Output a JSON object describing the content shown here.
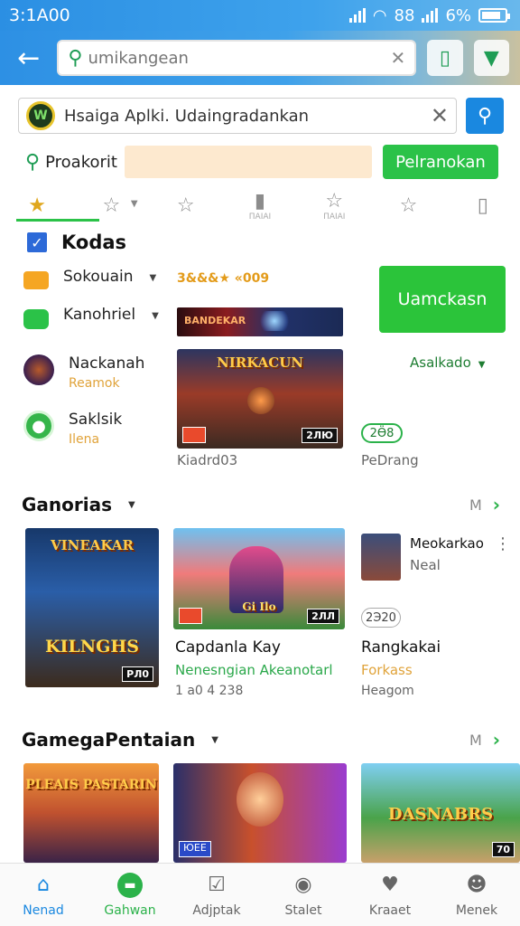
{
  "status_bar": {
    "time": "3:1A00",
    "right_text": "88",
    "battery_text": "6%"
  },
  "top_bar": {
    "search_placeholder": "umikangean"
  },
  "search2": {
    "text": "Hsaiga Aplki. Udaingradankan"
  },
  "filter": {
    "label": "Proakorit",
    "button": "Pelranokan"
  },
  "tabs": [
    {
      "name": "star-icon",
      "sub": ""
    },
    {
      "name": "star-outline-icon",
      "sub": ""
    },
    {
      "name": "star-outline-icon",
      "sub": ""
    },
    {
      "name": "folder-icon",
      "sub": "ПАІАІ"
    },
    {
      "name": "star-outline-icon",
      "sub": "ПАІАІ"
    },
    {
      "name": "star-outline-icon",
      "sub": ""
    },
    {
      "name": "bookmark-icon",
      "sub": ""
    }
  ],
  "kodas": {
    "title": "Kodas",
    "items": [
      {
        "label": "Sokouain",
        "sub": ""
      },
      {
        "label": "Kanohriel",
        "sub": ""
      },
      {
        "label": "Nackanah",
        "sub": "Reamok"
      },
      {
        "label": "Saklsik",
        "sub": "Ilena"
      }
    ],
    "rating_text": "3&&&★ «009",
    "banner_text": "BANDEKAR",
    "featured": {
      "art_title": "NIRKACUN",
      "tag": "2ЛЮ",
      "caption": "Kiadrd03"
    },
    "install_button": "Uamckasn",
    "asekado": "Asalkado",
    "pill": "2Ӫ8",
    "pill_caption": "PeDrang"
  },
  "section1": {
    "title": "Ganorias",
    "more": "M",
    "cards": [
      {
        "art_title": "VINEAKAR",
        "art_title2": "KILNGHS",
        "tag": "PЛ0",
        "title": "",
        "sub": "",
        "meta": ""
      },
      {
        "art_title": "Gi Ilo",
        "tag": "2ЛЛ",
        "title": "Capdanla Kay",
        "sub": "Nenesngian Akeanotarl",
        "meta": "1 a0 4 238"
      },
      {
        "art_title": "",
        "tag": "",
        "title": "Rangkakai",
        "sub": "Forkass",
        "meta": "Heagom",
        "side_title": "Meokarkao",
        "side_sub": "Neal",
        "pill": "2Э20"
      }
    ]
  },
  "section2": {
    "title": "GamegaPentaian",
    "more": "M",
    "cards": [
      {
        "art_title": "PLEAIS PASTARIN"
      },
      {
        "art_title": "",
        "tag": "ЮЕЕ"
      },
      {
        "art_title": "DASNABRS",
        "tag": "70"
      }
    ]
  },
  "bottom_nav": [
    {
      "label": "Nenad",
      "icon": "home-icon"
    },
    {
      "label": "Gahwan",
      "icon": "games-icon"
    },
    {
      "label": "Adjptak",
      "icon": "inbox-icon"
    },
    {
      "label": "Stalet",
      "icon": "search-circle-icon"
    },
    {
      "label": "Kraaet",
      "icon": "heart-icon"
    },
    {
      "label": "Menek",
      "icon": "person-icon"
    }
  ],
  "colors": {
    "primary_blue": "#1a88e0",
    "accent_green": "#2bc248",
    "rating_orange": "#e39b1a"
  }
}
